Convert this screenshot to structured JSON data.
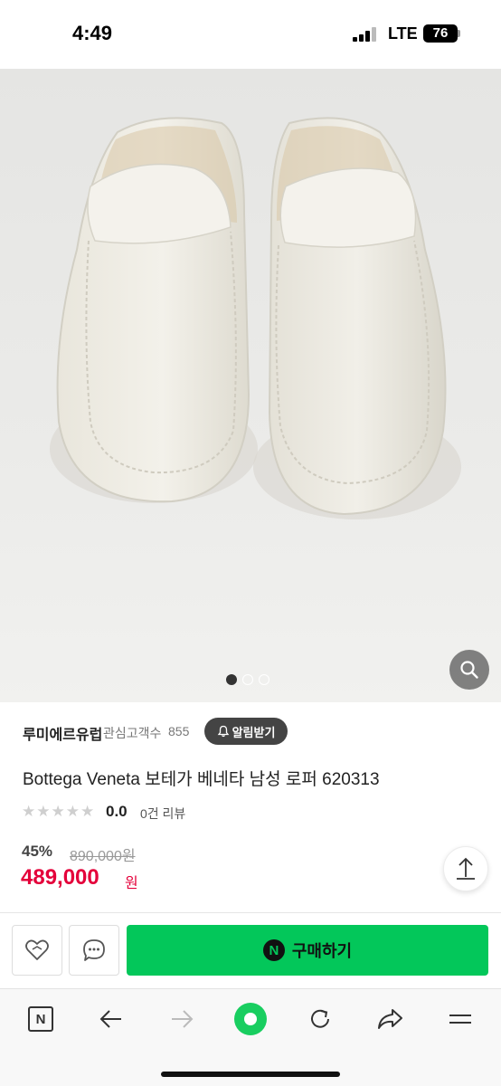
{
  "status_bar": {
    "time": "4:49",
    "network": "LTE",
    "battery": "76"
  },
  "gallery": {
    "page_count": 3,
    "active_index": 0
  },
  "store": {
    "name": "루미에르유럽",
    "follower_label": "관심고객수",
    "follower_count": "855",
    "alarm_label": "알림받기"
  },
  "product": {
    "title": "Bottega Veneta 보테가 베네타 남성 로퍼 620313",
    "rating": "0.0",
    "review_count": "0건 리뷰",
    "discount": "45%",
    "original_price": "890,000원",
    "sale_price": "489,000",
    "currency": "원"
  },
  "actions": {
    "buy_label": "구매하기",
    "naver_badge": "N"
  },
  "browser_toolbar": {
    "tab_label": "N"
  },
  "colors": {
    "sale": "#e4003a",
    "buy": "#03c75a",
    "accent_dark": "#444444"
  },
  "icons": [
    "search-icon",
    "bell-icon",
    "share-icon",
    "heart-icon",
    "chat-icon",
    "back-icon",
    "forward-icon",
    "refresh-icon",
    "share-arrow-icon",
    "menu-icon"
  ]
}
